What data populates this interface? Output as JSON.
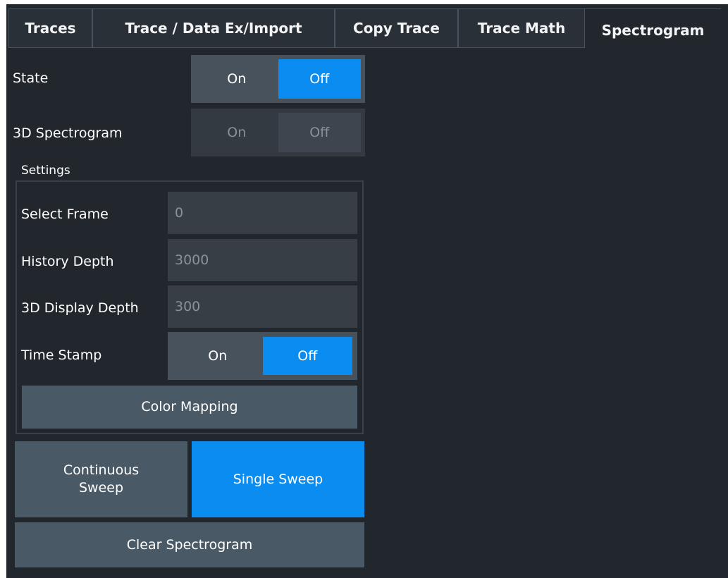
{
  "tabs": [
    {
      "label": "Traces"
    },
    {
      "label": "Trace / Data Ex/Import"
    },
    {
      "label": "Copy Trace"
    },
    {
      "label": "Trace Math"
    },
    {
      "label": "Spectrogram",
      "active": true
    }
  ],
  "state": {
    "label": "State",
    "on": "On",
    "off": "Off",
    "selected": "Off"
  },
  "spectrogram3d": {
    "label": "3D Spectrogram",
    "on": "On",
    "off": "Off",
    "selected": "Off",
    "enabled": false
  },
  "settings": {
    "title": "Settings",
    "select_frame": {
      "label": "Select Frame",
      "value": "0"
    },
    "history_depth": {
      "label": "History Depth",
      "value": "3000"
    },
    "display_depth_3d": {
      "label": "3D Display Depth",
      "value": "300"
    },
    "time_stamp": {
      "label": "Time Stamp",
      "on": "On",
      "off": "Off",
      "selected": "Off"
    },
    "color_mapping": "Color Mapping"
  },
  "sweep": {
    "continuous_line1": "Continuous",
    "continuous_line2": "Sweep",
    "single": "Single Sweep"
  },
  "clear_spectrogram": "Clear Spectrogram",
  "colors": {
    "background": "#22272e",
    "accent": "#0a8cf0",
    "button": "#4a5966",
    "field": "#383e46"
  }
}
